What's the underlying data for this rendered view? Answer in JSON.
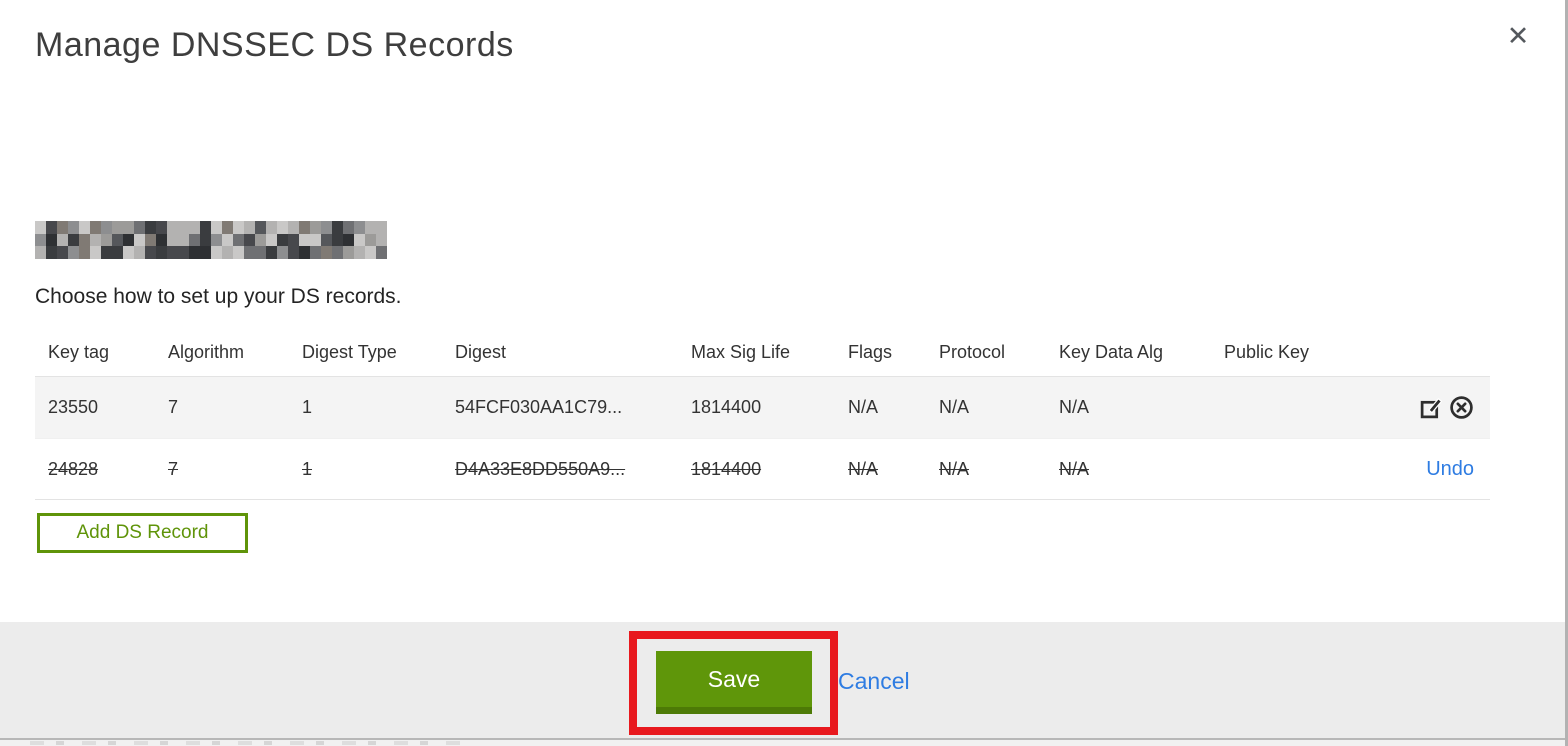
{
  "modal": {
    "title": "Manage DNSSEC DS Records",
    "close_icon_glyph": "✕",
    "instruction": "Choose how to set up your DS records.",
    "table": {
      "columns": [
        "Key tag",
        "Algorithm",
        "Digest Type",
        "Digest",
        "Max Sig Life",
        "Flags",
        "Protocol",
        "Key Data Alg",
        "Public Key"
      ],
      "rows": [
        {
          "state": "active",
          "cells": [
            "23550",
            "7",
            "1",
            "54FCF030AA1C79...",
            "1814400",
            "N/A",
            "N/A",
            "N/A",
            ""
          ],
          "actions": [
            "edit",
            "delete"
          ]
        },
        {
          "state": "deleted",
          "cells": [
            "24828",
            "7",
            "1",
            "D4A33E8DD550A9...",
            "1814400",
            "N/A",
            "N/A",
            "N/A",
            ""
          ],
          "action_label": "Undo"
        }
      ]
    },
    "add_button_label": "Add DS Record",
    "footer": {
      "save_label": "Save",
      "cancel_label": "Cancel"
    }
  },
  "redacted_domain": {
    "note": "domain name pixelated/blurred in source",
    "palette": [
      "#3a3c3f",
      "#55575b",
      "#6f7073",
      "#8d8e90",
      "#b3b2b1",
      "#c9c8c7",
      "#2e3033",
      "#807a74",
      "#9c9b99",
      "#47484c"
    ]
  },
  "colors": {
    "accent_green": "#5f960a",
    "green_border_dark": "#4d7a06",
    "link_blue": "#2e7ce2",
    "annotation_red": "#e8191e",
    "footer_bg": "#ececec",
    "row_alt_bg": "#f4f4f4",
    "text_dark": "#333333"
  }
}
